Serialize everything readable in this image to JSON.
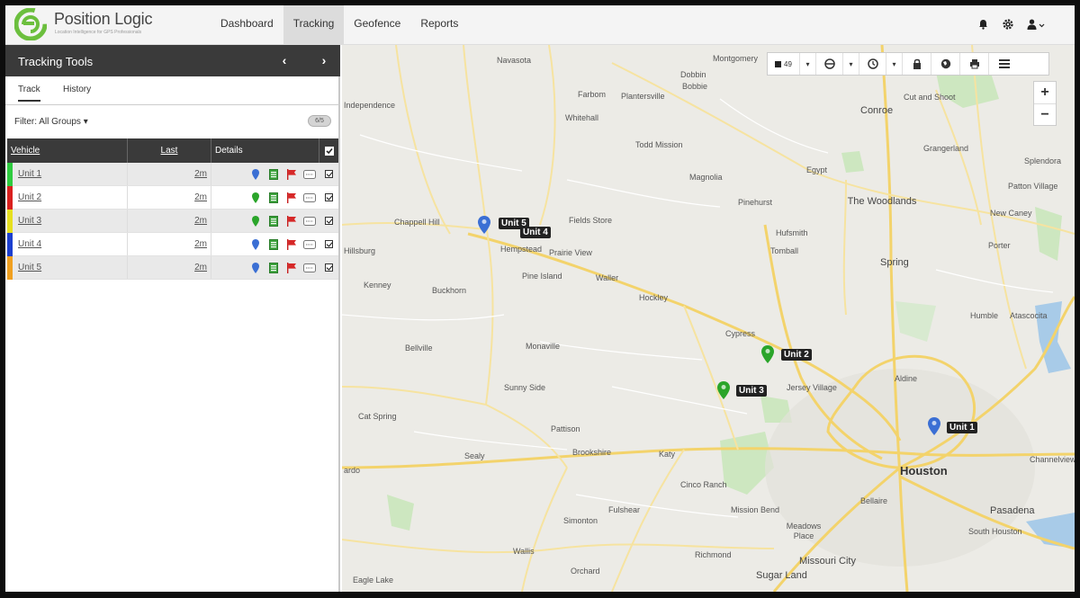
{
  "brand": {
    "name": "Position Logic",
    "tagline": "Location Intelligence for GPS Professionals",
    "accent": "#6cbf3e"
  },
  "nav": {
    "items": [
      "Dashboard",
      "Tracking",
      "Geofence",
      "Reports"
    ],
    "active": "Tracking"
  },
  "panel": {
    "title": "Tracking Tools",
    "tabs": [
      "Track",
      "History"
    ],
    "filter_label": "Filter: All Groups ▾",
    "toggle_label": "6/5",
    "columns": {
      "vehicle": "Vehicle",
      "last": "Last",
      "details": "Details"
    },
    "rows": [
      {
        "vehicle": "Unit 1",
        "last": "2m",
        "color": "#2ecc40",
        "pin_color": "#3b6fd4"
      },
      {
        "vehicle": "Unit 2",
        "last": "2m",
        "color": "#d9201f",
        "pin_color": "#2aa52a"
      },
      {
        "vehicle": "Unit 3",
        "last": "2m",
        "color": "#e6e020",
        "pin_color": "#2aa52a"
      },
      {
        "vehicle": "Unit 4",
        "last": "2m",
        "color": "#1c3fcf",
        "pin_color": "#3b6fd4"
      },
      {
        "vehicle": "Unit 5",
        "last": "2m",
        "color": "#f0a020",
        "pin_color": "#3b6fd4"
      }
    ]
  },
  "map": {
    "labels": {
      "navasota": "Navasota",
      "montgomery": "Montgomery",
      "dobbin": "Dobbin",
      "bobbie": "Bobbie",
      "farbom": "Farbom",
      "plantersville": "Plantersville",
      "independence": "Independence",
      "conroe": "Conroe",
      "cutandshoot": "Cut and Shoot",
      "whitehall": "Whitehall",
      "toddmission": "Todd Mission",
      "grangerland": "Grangerland",
      "magnolia": "Magnolia",
      "egypt": "Egypt",
      "splendora": "Splendora",
      "pinehurst": "Pinehurst",
      "woodlands": "The Woodlands",
      "patton": "Patton Village",
      "chappell": "Chappell Hill",
      "fields": "Fields Store",
      "newcaney": "New Caney",
      "hempstead": "Hempstead",
      "prairie": "Prairie View",
      "hufsmith": "Hufsmith",
      "tomball": "Tomball",
      "porter": "Porter",
      "brenham": "Hillsburg",
      "spring": "Spring",
      "pineisland": "Pine Island",
      "waller": "Waller",
      "kenney": "Kenney",
      "buckhorn": "Buckhorn",
      "hockley": "Hockley",
      "humble": "Humble",
      "atascocita": "Atascocita",
      "cypress": "Cypress",
      "bellville": "Bellville",
      "monaville": "Monaville",
      "aldine": "Aldine",
      "jersey": "Jersey Village",
      "sunnyside": "Sunny Side",
      "catspring": "Cat Spring",
      "pattison": "Pattison",
      "houston": "Houston",
      "sealy": "Sealy",
      "brookshire": "Brookshire",
      "katy": "Katy",
      "channelview": "Channelview",
      "cincoranch": "Cinco Ranch",
      "fulshear": "Fulshear",
      "bellaire": "Bellaire",
      "missionbend": "Mission Bend",
      "pasadena": "Pasadena",
      "simonton": "Simonton",
      "meadows": "Meadows Place",
      "southhouston": "South Houston",
      "wallis": "Wallis",
      "richmond": "Richmond",
      "missouri": "Missouri City",
      "orchard": "Orchard",
      "sugarland": "Sugar Land",
      "eaglelake": "Eagle Lake",
      "frydo": "ardo"
    },
    "units": [
      {
        "label": "Unit 1",
        "pin_color": "#3b6fd4"
      },
      {
        "label": "Unit 2",
        "pin_color": "#2aa52a"
      },
      {
        "label": "Unit 3",
        "pin_color": "#2aa52a"
      },
      {
        "label": "Unit 4",
        "pin_color": "#3b6fd4"
      },
      {
        "label": "Unit 5",
        "pin_color": "#3b6fd4"
      }
    ],
    "toolbar_count": "49"
  }
}
